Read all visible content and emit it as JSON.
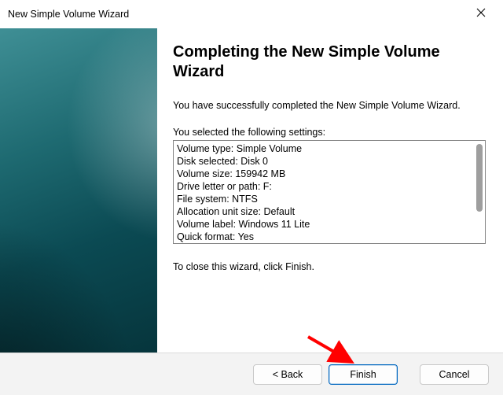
{
  "window": {
    "title": "New Simple Volume Wizard"
  },
  "heading": "Completing the New Simple Volume Wizard",
  "intro": "You have successfully completed the New Simple Volume Wizard.",
  "settings_label": "You selected the following settings:",
  "settings": [
    "Volume type: Simple Volume",
    "Disk selected: Disk 0",
    "Volume size: 159942 MB",
    "Drive letter or path: F:",
    "File system: NTFS",
    "Allocation unit size: Default",
    "Volume label: Windows 11 Lite",
    "Quick format: Yes"
  ],
  "close_note": "To close this wizard, click Finish.",
  "buttons": {
    "back": "< Back",
    "finish": "Finish",
    "cancel": "Cancel"
  }
}
